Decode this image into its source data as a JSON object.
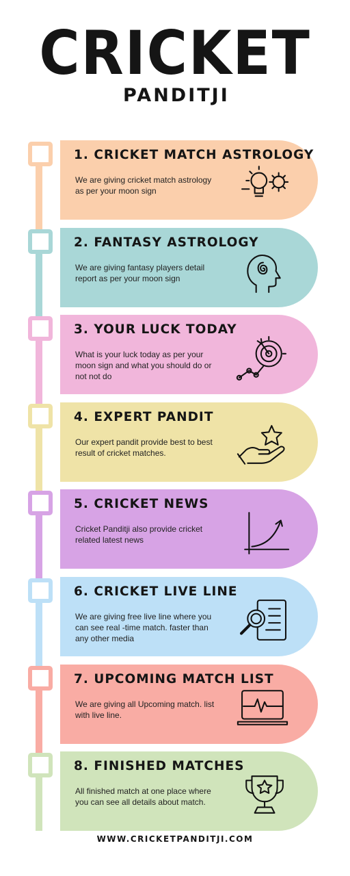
{
  "header": {
    "title": "CRICKET",
    "subtitle": "PANDITJI"
  },
  "items": [
    {
      "heading": "1. CRICKET MATCH ASTROLOGY",
      "description": "We are giving cricket match astrology as per your moon sign",
      "icon": "lightbulb-gear-icon",
      "color": "#fbcfac"
    },
    {
      "heading": "2. FANTASY ASTROLOGY",
      "description": "We are giving fantasy players detail report as per your moon sign",
      "icon": "head-spiral-icon",
      "color": "#a9d7d7"
    },
    {
      "heading": "3. YOUR LUCK TODAY",
      "description": "What is your luck today  as per your moon sign and what you should do or not not do",
      "icon": "target-growth-icon",
      "color": "#f1b6db"
    },
    {
      "heading": "4. EXPERT PANDIT",
      "description": "Our expert pandit provide best to best result of cricket matches.",
      "icon": "hand-star-icon",
      "color": "#efe3a7"
    },
    {
      "heading": "5. CRICKET NEWS",
      "description": "Cricket Panditji also provide cricket related latest news",
      "icon": "growth-chart-icon",
      "color": "#d7a3e5"
    },
    {
      "heading": "6. CRICKET LIVE LINE",
      "description": "We are giving free live line where you can see real -time match. faster than any other media",
      "icon": "magnifier-document-icon",
      "color": "#bde0f7"
    },
    {
      "heading": "7. UPCOMING MATCH LIST",
      "description": "We are giving all Upcoming match. list with live line.",
      "icon": "laptop-pulse-icon",
      "color": "#f9aca4"
    },
    {
      "heading": "8. FINISHED MATCHES",
      "description": "All finished match at one place where you can see all details about match.",
      "icon": "trophy-star-icon",
      "color": "#d0e4bb"
    }
  ],
  "footer": {
    "website": "WWW.CRICKETPANDITJI.COM"
  }
}
